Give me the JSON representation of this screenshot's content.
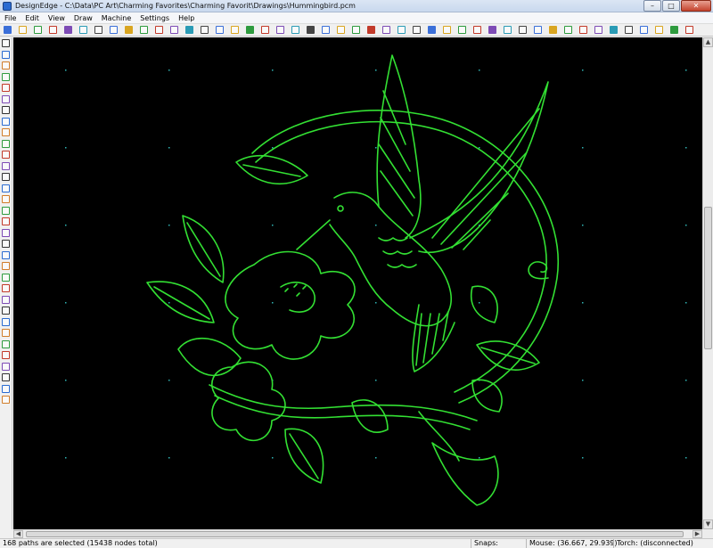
{
  "window": {
    "app_name": "DesignEdge",
    "title": "DesignEdge - C:\\Data\\PC Art\\Charming Favorites\\Charming Favorit\\Drawings\\Hummingbird.pcm",
    "minimize_glyph": "–",
    "maximize_glyph": "□",
    "close_glyph": "✕"
  },
  "menu": [
    "File",
    "Edit",
    "View",
    "Draw",
    "Machine",
    "Settings",
    "Help"
  ],
  "toolbar_icons": [
    "new-file-icon",
    "open-folder-icon",
    "save-icon",
    "save-as-icon",
    "import-icon",
    "export-icon",
    "print-icon",
    "print-preview-icon",
    "properties-icon",
    "undo-icon",
    "redo-icon",
    "group-icon",
    "ungroup-icon",
    "rectangle-icon",
    "rounded-rect-icon",
    "parallelogram-icon",
    "square-icon",
    "circle-icon",
    "polygon-icon",
    "ellipse-icon",
    "star-icon",
    "cut-path-icon",
    "break-path-icon",
    "join-icon",
    "trim-icon",
    "node-delete-icon",
    "arc-icon",
    "fillet-icon",
    "offset-icon",
    "zoom-in-icon",
    "zoom-out-icon",
    "zoom-window-icon",
    "zoom-fit-icon",
    "zoom-previous-icon",
    "zoom-select-icon",
    "pan-icon",
    "fit-page-icon",
    "select-pointer-icon",
    "select-node-icon",
    "marquee-icon",
    "mirror-icon",
    "rotate-icon",
    "align-icon",
    "distribute-icon",
    "lead-in-icon",
    "settings-icon"
  ],
  "left_tools": [
    "select-icon",
    "node-edit-icon",
    "grid-snap-icon",
    "line-icon",
    "arc-tool-icon",
    "point-icon",
    "rectangle-tool-icon",
    "circle-center-icon",
    "circle-3pt-icon",
    "rotate-tool-icon",
    "arc-3pt-icon",
    "curve-icon",
    "spline-icon",
    "bezier-icon",
    "spiral-icon",
    "text-icon",
    "dimension-icon",
    "measure-icon",
    "move-icon",
    "copy-icon",
    "scale-icon",
    "clock-icon",
    "offset-tool-icon",
    "corner-icon",
    "fillet-tool-icon",
    "chamfer-icon",
    "extend-icon",
    "trim-tool-icon",
    "break-icon",
    "split-icon",
    "join-tool-icon",
    "explode-icon",
    "delete-icon"
  ],
  "canvas": {
    "background": "#000000",
    "stroke_color": "#33e033",
    "grid_dot_color": "#2fb3b3",
    "drawing_name": "Hummingbird"
  },
  "statusbar": {
    "selection": "168 paths are selected (15438 nodes total)",
    "snaps_label": "Snaps:",
    "snaps_value": "",
    "mouse_label": "Mouse:",
    "mouse_value": "(36.667, 29.939)",
    "torch_label": "Torch:",
    "torch_value": "(disconnected)"
  }
}
